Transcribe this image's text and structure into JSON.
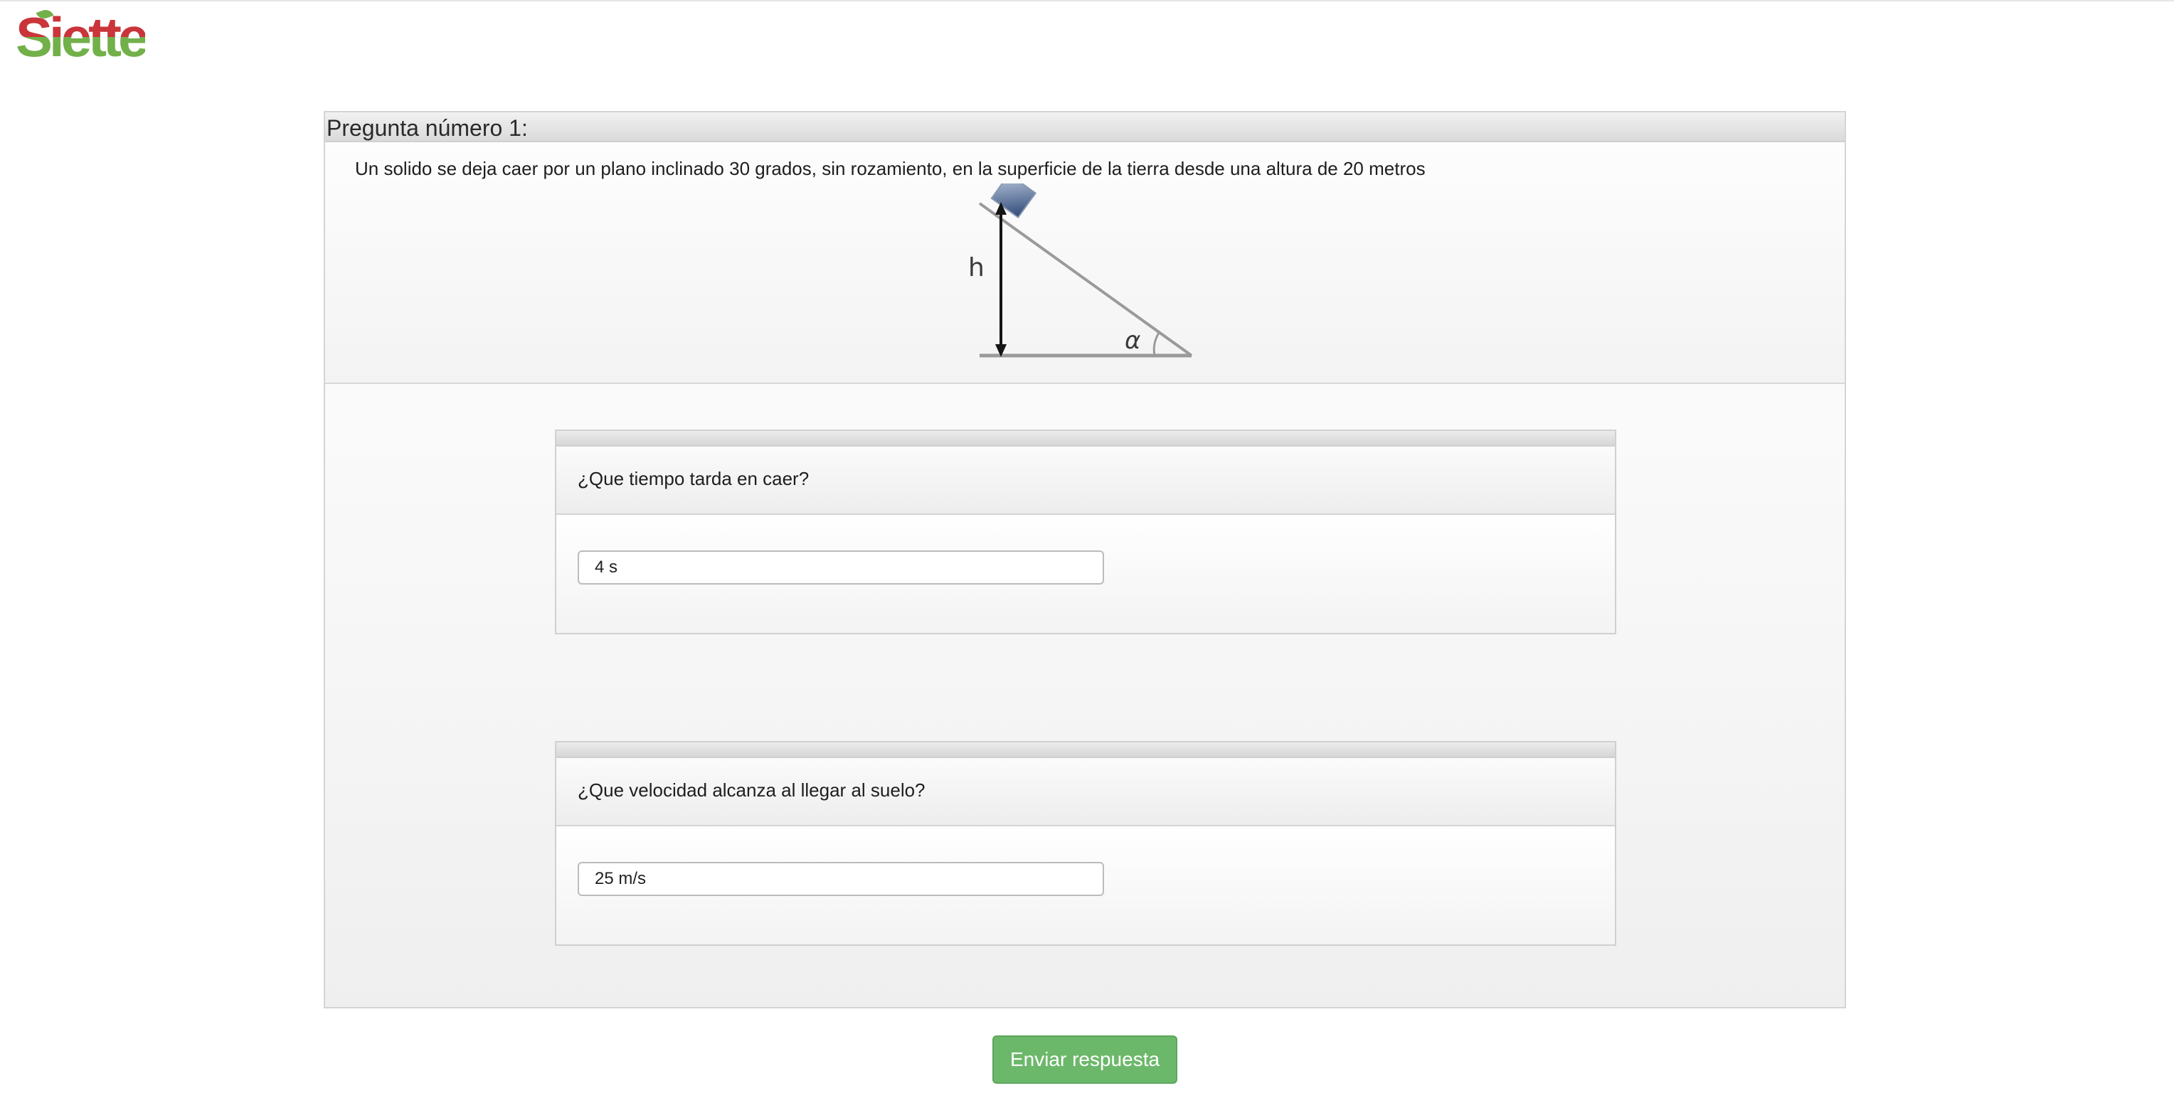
{
  "brand": {
    "logo_text": "Siette",
    "logo_red": "#c9353a",
    "logo_green": "#72b04a"
  },
  "question": {
    "title": "Pregunta número 1:",
    "statement": "Un solido se deja caer por un plano inclinado 30 grados, sin rozamiento, en la superficie de la tierra desde una altura de 20 metros",
    "figure": {
      "height_label": "h",
      "angle_label": "α"
    }
  },
  "subquestions": [
    {
      "prompt": "¿Que tiempo tarda en caer?",
      "answer_value": "4 s"
    },
    {
      "prompt": "¿Que velocidad alcanza al llegar al suelo?",
      "answer_value": "25 m/s"
    }
  ],
  "actions": {
    "submit_label": "Enviar respuesta",
    "submit_color": "#6cb86a"
  }
}
